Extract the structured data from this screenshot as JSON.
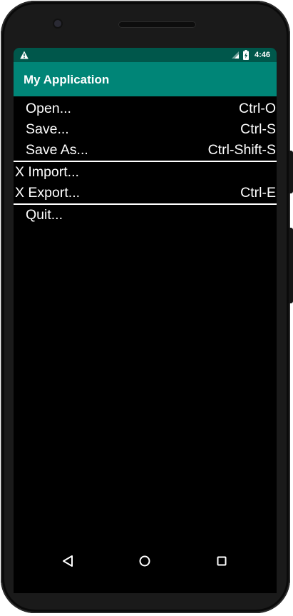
{
  "status_bar": {
    "time": "4:46",
    "icons": [
      "warning-icon",
      "signal-icon",
      "battery-icon"
    ]
  },
  "app_bar": {
    "title": "My Application",
    "color": "#008577",
    "status_color": "#00574b"
  },
  "menu": {
    "items": [
      {
        "label": "Open...",
        "shortcut": "Ctrl-O"
      },
      {
        "label": "Save...",
        "shortcut": "Ctrl-S"
      },
      {
        "label": "Save As...",
        "shortcut": "Ctrl-Shift-S"
      },
      {
        "label": "X Import...",
        "shortcut": ""
      },
      {
        "label": "X Export...",
        "shortcut": "Ctrl-E"
      },
      {
        "label": "Quit...",
        "shortcut": ""
      }
    ]
  },
  "nav_bar": {
    "buttons": [
      "back-icon",
      "home-icon",
      "recents-icon"
    ]
  }
}
